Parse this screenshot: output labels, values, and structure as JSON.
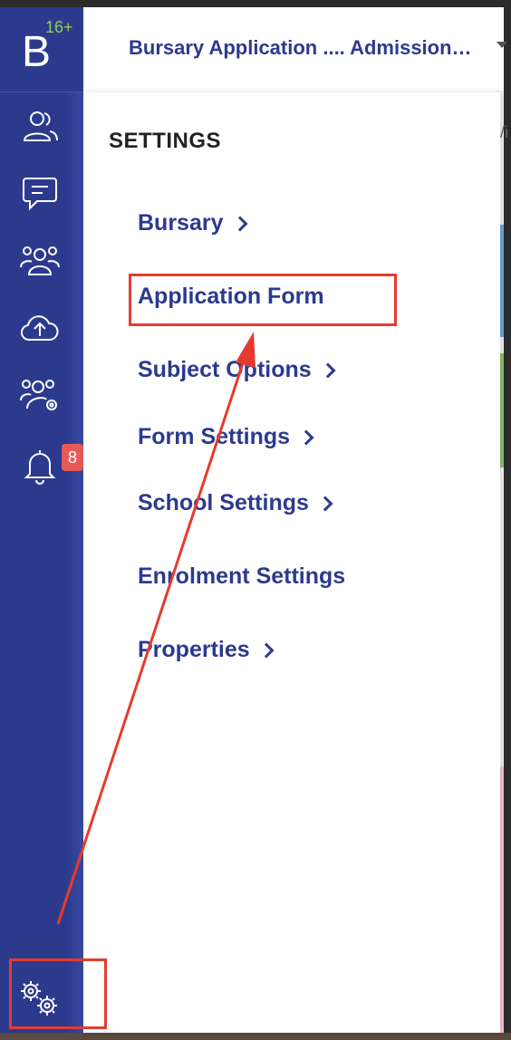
{
  "brand": {
    "letter": "B",
    "badge": "16+"
  },
  "header": {
    "title": "Bursary Application .... Admission…"
  },
  "background": {
    "peek_text": "/i"
  },
  "notifications": {
    "count": "8"
  },
  "panel": {
    "title": "SETTINGS",
    "items": [
      {
        "label": "Bursary",
        "has_chevron": true
      },
      {
        "label": "Application Form",
        "has_chevron": false
      },
      {
        "label": "Subject Options",
        "has_chevron": true
      },
      {
        "label": "Form Settings",
        "has_chevron": true
      },
      {
        "label": "School Settings",
        "has_chevron": true
      },
      {
        "label": "Enrolment Settings",
        "has_chevron": false
      },
      {
        "label": "Properties",
        "has_chevron": true
      }
    ]
  },
  "sidebar": {
    "icons": [
      "users-icon",
      "chat-icon",
      "group-icon",
      "cloud-upload-icon",
      "group-settings-icon",
      "bell-icon"
    ],
    "settings_icon": "gears-icon"
  },
  "colors": {
    "brand_blue": "#2c3a8e",
    "badge_green": "#8fd14f",
    "notification_red": "#e85a5a",
    "annotation_red": "#e53b2f"
  }
}
